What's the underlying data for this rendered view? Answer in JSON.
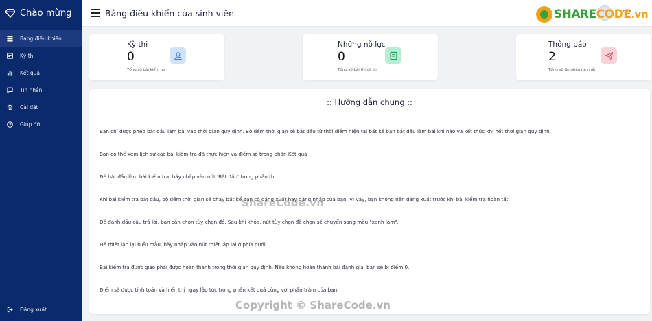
{
  "sidebar": {
    "brand": "Chào mừng",
    "items": [
      {
        "label": "Bảng điều khiển",
        "icon": "dashboard-icon"
      },
      {
        "label": "Kỳ thi",
        "icon": "exam-icon"
      },
      {
        "label": "Kết quả",
        "icon": "chart-icon"
      },
      {
        "label": "Tin nhắn",
        "icon": "message-icon"
      },
      {
        "label": "Cài đặt",
        "icon": "gear-icon"
      },
      {
        "label": "Giúp đỡ",
        "icon": "help-icon"
      }
    ],
    "logout": "Đăng xuất"
  },
  "header": {
    "title": "Bảng điều khiển của sinh viên",
    "logo_text_a": "SHARE",
    "logo_text_b": "CODE",
    "logo_text_c": ".vn",
    "avatar_label": "rank"
  },
  "stats": [
    {
      "title": "Kỳ thi",
      "value": "0",
      "sub": "Tổng số bài kiểm tra",
      "icon": "user-icon"
    },
    {
      "title": "Những nỗ lực",
      "value": "0",
      "sub": "Tổng số bài thi đã thi",
      "icon": "book-icon"
    },
    {
      "title": "Thông báo",
      "value": "2",
      "sub": "Tổng số tin nhắn đã nhắn",
      "icon": "send-icon"
    }
  ],
  "guide": {
    "title": ":: Hướng dẫn chung ::",
    "rules": [
      "Bạn chỉ được phép bắt đầu làm bài vào thời gian quy định. Bộ đếm thời gian sẽ bắt đầu từ thời điểm hiện tại bất kể bạn bắt đầu làm bài khi nào và kết thúc khi hết thời gian quy định.",
      "Bạn có thể xem lịch sử các bài kiểm tra đã thực hiện và điểm số trong phần Kết quả",
      "Để bắt đầu làm bài kiểm tra, hãy nhấp vào nút 'Bắt đầu' trong phần thi.",
      "Khi bài kiểm tra bắt đầu, bộ đếm thời gian sẽ chạy bất kể bạn có đăng xuất hay đăng nhập của bạn. Vì vậy, bạn không nên đăng xuất trước khi bài kiểm tra hoàn tất.",
      "Để đánh dấu câu trả lời, bạn cần chọn tùy chọn đó. Sau khi khóa, nút tùy chọn đã chọn sẽ chuyển sang màu \"xanh lam\".",
      "Để thiết lập lại biểu mẫu, hãy nhấp vào nút thiết lập lại ở phía dưới.",
      "Bài kiểm tra được giao phải được hoàn thành trong thời gian quy định. Nếu không hoàn thành bài đánh giá, bạn sẽ bị điểm 0.",
      "Điểm sẽ được tính toán và hiển thị ngay lập tức trong phần kết quả cùng với phần trăm của bạn."
    ]
  },
  "watermarks": {
    "middle": "ShareCode.vn",
    "bottom": "Copyright © ShareCode.vn"
  },
  "colors": {
    "sidebar_bg": "#0a2a6b",
    "sidebar_active": "#1d3a7e",
    "card1_icon_bg": "#cfe3fb",
    "card2_icon_bg": "#b9ecd1",
    "card3_icon_bg": "#fbd2d8"
  }
}
